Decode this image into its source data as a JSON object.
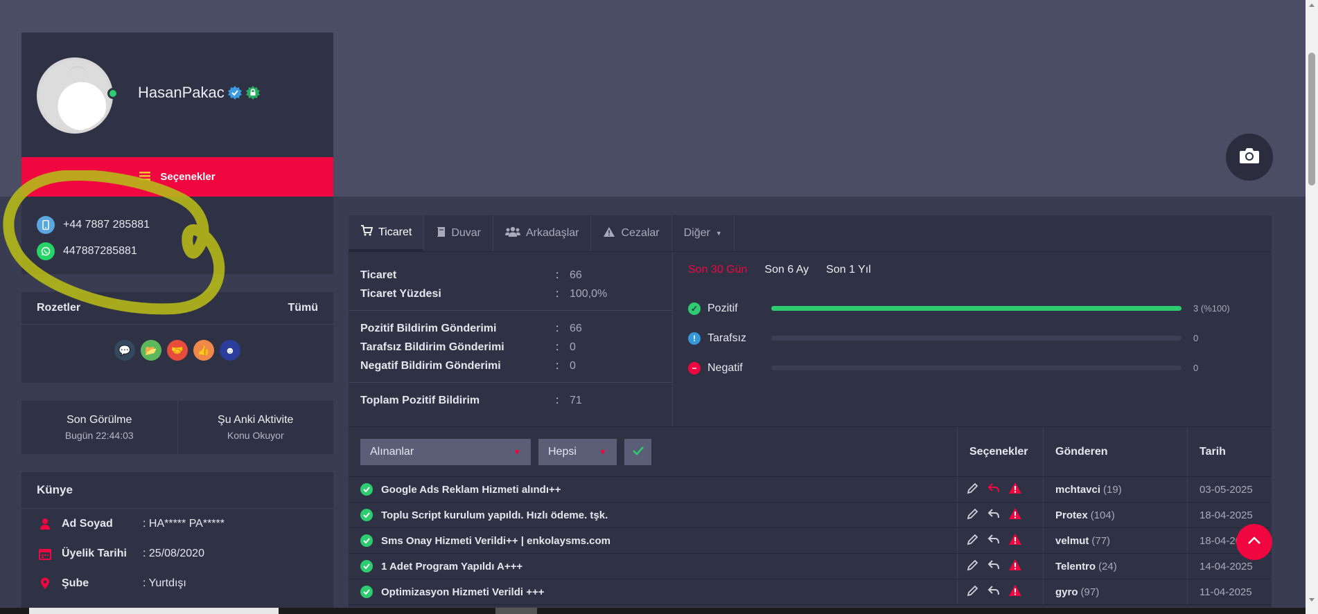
{
  "profile": {
    "username": "HasanPakac",
    "options_label": "Seçenekler"
  },
  "contact": {
    "phone": "+44 7887 285881",
    "whatsapp": "447887285881"
  },
  "badges": {
    "title": "Rozetler",
    "all_label": "Tümü",
    "icons": [
      "chat-bubbles-icon",
      "folder-icon",
      "handshake-icon",
      "thumbs-up-icon",
      "smiley-icon"
    ]
  },
  "seen": {
    "last_seen_title": "Son Görülme",
    "last_seen_value": "Bugün 22:44:03",
    "activity_title": "Şu Anki Aktivite",
    "activity_value": "Konu Okuyor"
  },
  "kunye": {
    "title": "Künye",
    "rows": [
      {
        "label": "Ad Soyad",
        "value": ": HA***** PA*****",
        "icon": "user-icon"
      },
      {
        "label": "Üyelik Tarihi",
        "value": ": 25/08/2020",
        "icon": "calendar-icon"
      },
      {
        "label": "Şube",
        "value": ": Yurtdışı",
        "icon": "map-pin-icon"
      }
    ]
  },
  "tabs": [
    {
      "label": "Ticaret",
      "icon": "cart-icon",
      "active": true
    },
    {
      "label": "Duvar",
      "icon": "book-icon",
      "active": false
    },
    {
      "label": "Arkadaşlar",
      "icon": "users-icon",
      "active": false
    },
    {
      "label": "Cezalar",
      "icon": "warning-icon",
      "active": false
    },
    {
      "label": "Diğer",
      "icon": "caret-down-icon",
      "active": false
    }
  ],
  "stats": {
    "rows": [
      {
        "label": "Ticaret",
        "value": "66"
      },
      {
        "label": "Ticaret Yüzdesi",
        "value": "100,0%"
      },
      {
        "label": "Pozitif Bildirim Gönderimi",
        "value": "66"
      },
      {
        "label": "Tarafsız Bildirim Gönderimi",
        "value": "0"
      },
      {
        "label": "Negatif Bildirim Gönderimi",
        "value": "0"
      },
      {
        "label": "Toplam Pozitif Bildirim",
        "value": "71"
      }
    ],
    "colon": ":"
  },
  "periods": [
    "Son 30 Gün",
    "Son 6 Ay",
    "Son 1 Yıl"
  ],
  "feedback": [
    {
      "label": "Pozitif",
      "value": "3 (%100)",
      "fill": 1.0,
      "color": "#2ecc71"
    },
    {
      "label": "Tarafsız",
      "value": "0",
      "fill": 0,
      "color": "#3498db"
    },
    {
      "label": "Negatif",
      "value": "0",
      "fill": 0,
      "color": "#f0073f"
    }
  ],
  "list": {
    "filter_type": "Alınanlar",
    "filter_all": "Hepsi",
    "headers": {
      "options": "Seçenekler",
      "sender": "Gönderen",
      "date": "Tarih"
    },
    "rows": [
      {
        "text": "Google Ads Reklam Hizmeti alındı++",
        "sender": "mchtavci",
        "count": "(19)",
        "date": "03-05-2025",
        "reply_active": true
      },
      {
        "text": "Toplu Script kurulum yapıldı. Hızlı ödeme. tşk.",
        "sender": "Protex",
        "count": "(104)",
        "date": "18-04-2025",
        "reply_active": false
      },
      {
        "text": "Sms Onay Hizmeti Verildi++ | enkolaysms.com",
        "sender": "velmut",
        "count": "(77)",
        "date": "18-04-20",
        "reply_active": false
      },
      {
        "text": "1 Adet Program Yapıldı A+++",
        "sender": "Telentro",
        "count": "(24)",
        "date": "14-04-2025",
        "reply_active": false
      },
      {
        "text": "Optimizasyon Hizmeti Verildi +++",
        "sender": "gyro",
        "count": "(97)",
        "date": "11-04-2025",
        "reply_active": false
      }
    ]
  },
  "colors": {
    "accent": "#f0073f",
    "positive": "#2ecc71",
    "panel": "#2f3144",
    "background": "#4a4d63",
    "annotation": "#b5b81a"
  }
}
